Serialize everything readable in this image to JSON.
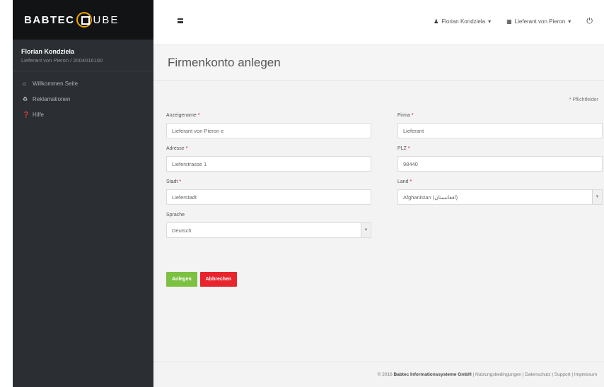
{
  "logo": {
    "part1": "BABTEC",
    "part2": "UBE"
  },
  "user": {
    "name": "Florian Kondziela",
    "subtitle": "Lieferant von Pieron / 2004016100"
  },
  "sidebar": {
    "items": [
      {
        "label": "Willkommen Seite",
        "icon": "home-icon"
      },
      {
        "label": "Reklamationen",
        "icon": "recycle-icon"
      },
      {
        "label": "Hilfe",
        "icon": "help-icon"
      }
    ]
  },
  "topbar": {
    "user_label": "Florian Kondziela",
    "company_label": "Lieferant von Pieron",
    "caret": "▾"
  },
  "page": {
    "title": "Firmenkonto anlegen"
  },
  "form": {
    "required_note": "* Pflichtfelder",
    "fields": {
      "anzeigename": {
        "label": "Anzeigename",
        "value": "Lieferant von Pieron e"
      },
      "firma": {
        "label": "Firma",
        "value": "Lieferant"
      },
      "adresse": {
        "label": "Adresse",
        "value": "Lieferstrasse 1"
      },
      "plz": {
        "label": "PLZ",
        "value": "98440"
      },
      "stadt": {
        "label": "Stadt",
        "value": "Lieferstadt"
      },
      "land": {
        "label": "Land",
        "value": "Afghanistan (افغانستان)"
      },
      "sprache": {
        "label": "Sprache",
        "value": "Deutsch"
      }
    },
    "required_marker": "*",
    "save_label": "Anlegen",
    "cancel_label": "Abbrechen"
  },
  "footer": {
    "prefix": "© 2016",
    "company": "Babtec Informationssysteme GmbH",
    "links": "| Nutzungsbedingungen | Datenschutz | Support | Impressum"
  },
  "colors": {
    "sidebar": "#2b2f33",
    "accent": "#f0a400",
    "save": "#7cc142",
    "cancel": "#e8242c"
  }
}
